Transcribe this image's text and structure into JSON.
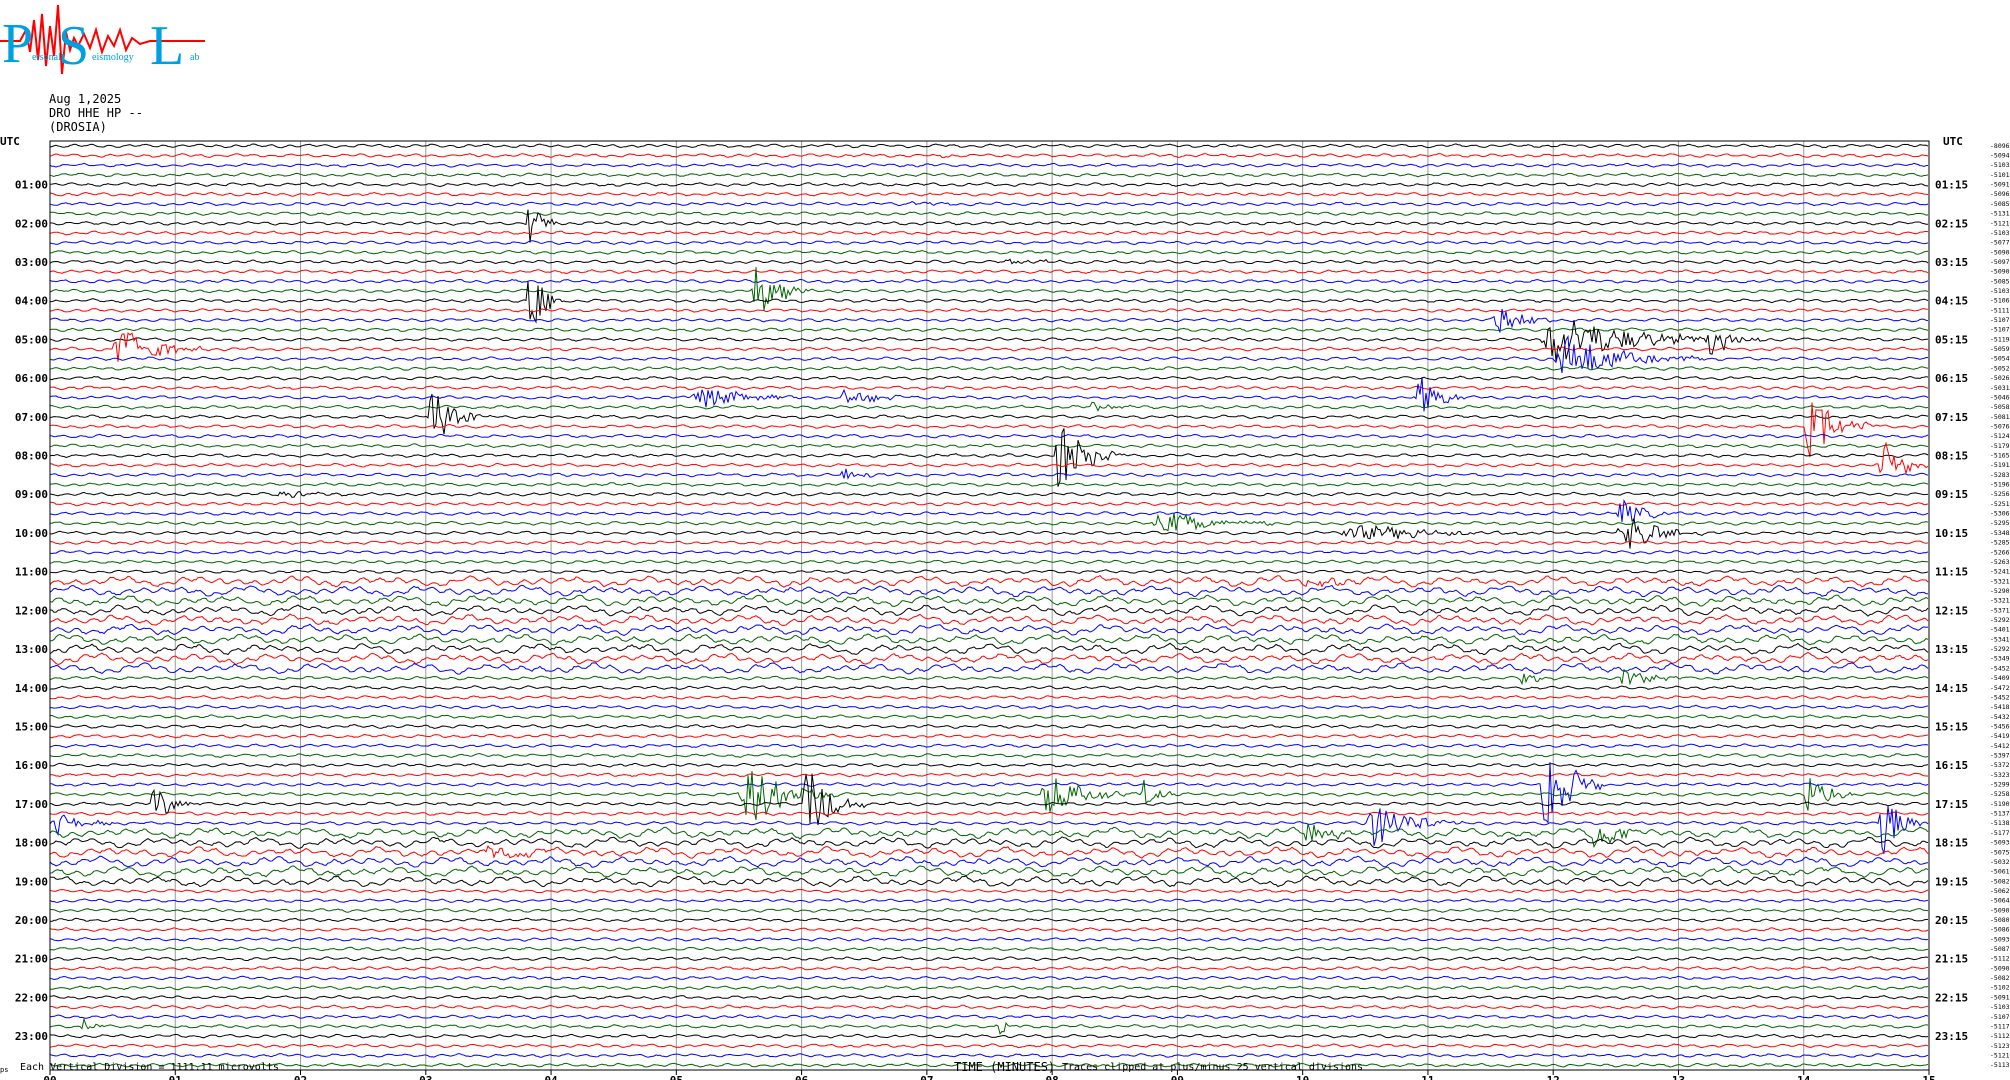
{
  "logo": {
    "letters": [
      "P",
      "S",
      "L"
    ],
    "text_fragments": [
      "ersonal",
      "eismology",
      "ab"
    ],
    "colors": {
      "letters": "#00a0e0",
      "trace": "#ff0000"
    }
  },
  "header": {
    "date": "Aug 1,2025",
    "station": "DRO HHE HP --",
    "place": "(DROSIA)"
  },
  "footer": {
    "mark": "ps",
    "scale_note": "Each Vertical Division = 1111.11 microvolts",
    "xlabel": "TIME (MINUTES)",
    "clip_note": "Traces clipped at plus/minus 25 vertical divisions"
  },
  "chart_data": {
    "type": "line",
    "subtype": "helicorder",
    "x_range": [
      0,
      15
    ],
    "x_unit": "minutes",
    "x_ticks": [
      "00",
      "01",
      "02",
      "03",
      "04",
      "05",
      "06",
      "07",
      "08",
      "09",
      "10",
      "11",
      "12",
      "13",
      "14",
      "15"
    ],
    "left_axis_title": "UTC",
    "right_axis_title": "UTC",
    "left_time_labels": [
      "01:00",
      "02:00",
      "03:00",
      "04:00",
      "05:00",
      "06:00",
      "07:00",
      "08:00",
      "09:00",
      "10:00",
      "11:00",
      "12:00",
      "13:00",
      "14:00",
      "15:00",
      "16:00",
      "17:00",
      "18:00",
      "19:00",
      "20:00",
      "21:00",
      "22:00",
      "23:00"
    ],
    "right_time_labels": [
      "01:15",
      "02:15",
      "03:15",
      "04:15",
      "05:15",
      "06:15",
      "07:15",
      "08:15",
      "09:15",
      "10:15",
      "11:15",
      "12:15",
      "13:15",
      "14:15",
      "15:15",
      "16:15",
      "17:15",
      "18:15",
      "19:15",
      "20:15",
      "21:15",
      "22:15",
      "23:15"
    ],
    "line_count": 96,
    "line_duration_minutes": 15,
    "trace_colors": [
      "#000000",
      "#ff0000",
      "#0000ff",
      "#006400"
    ],
    "right_offsets": [
      "-8096",
      "-5094",
      "-5103",
      "-5101",
      "-5091",
      "-5096",
      "-5085",
      "-5131",
      "-5121",
      "-5103",
      "-5077",
      "-5090",
      "-5097",
      "-5090",
      "-5085",
      "-5103",
      "-5106",
      "-5111",
      "-5107",
      "-5107",
      "-5119",
      "-5059",
      "-5054",
      "-5052",
      "-5026",
      "-5031",
      "-5046",
      "-5058",
      "-5081",
      "-5076",
      "-5124",
      "-5179",
      "-5165",
      "-5191",
      "-5283",
      "-5196",
      "-5256",
      "-5251",
      "-5306",
      "-5295",
      "-5348",
      "-5285",
      "-5266",
      "-5263",
      "-5241",
      "-5321",
      "-5290",
      "-5321",
      "-5371",
      "-5292",
      "-5401",
      "-5341",
      "-5292",
      "-5349",
      "-5452",
      "-5409",
      "-5472",
      "-5452",
      "-5418",
      "-5432",
      "-5456",
      "-5419",
      "-5412",
      "-5397",
      "-5372",
      "-5323",
      "-5299",
      "-5258",
      "-5190",
      "-5137",
      "-5138",
      "-5177",
      "-5093",
      "-5075",
      "-5032",
      "-5061",
      "-5082",
      "-5062",
      "-5064",
      "-5090",
      "-5080",
      "-5086",
      "-5093",
      "-5087",
      "-5112",
      "-5090",
      "-5082",
      "-5102",
      "-5091",
      "-5103",
      "-5107",
      "-5117",
      "-5112",
      "-5123",
      "-5121",
      "-5113"
    ],
    "events": [
      {
        "line": 1,
        "minute": 7.05,
        "dur": 0.25,
        "amp": 4
      },
      {
        "line": 6,
        "minute": 6.85,
        "dur": 0.4,
        "amp": 5
      },
      {
        "line": 8,
        "minute": 3.8,
        "dur": 0.3,
        "amp": 28
      },
      {
        "line": 12,
        "minute": 7.6,
        "dur": 0.6,
        "amp": 5
      },
      {
        "line": 15,
        "minute": 5.6,
        "dur": 0.5,
        "amp": 40
      },
      {
        "line": 16,
        "minute": 3.8,
        "dur": 0.3,
        "amp": 55
      },
      {
        "line": 18,
        "minute": 11.5,
        "dur": 0.5,
        "amp": 30
      },
      {
        "line": 20,
        "minute": 11.9,
        "dur": 1.5,
        "amp": 35
      },
      {
        "line": 20,
        "minute": 13.2,
        "dur": 0.5,
        "amp": 22
      },
      {
        "line": 21,
        "minute": 0.5,
        "dur": 0.7,
        "amp": 35
      },
      {
        "line": 22,
        "minute": 12.0,
        "dur": 1.2,
        "amp": 30
      },
      {
        "line": 26,
        "minute": 5.1,
        "dur": 0.9,
        "amp": 16
      },
      {
        "line": 26,
        "minute": 6.3,
        "dur": 0.6,
        "amp": 12
      },
      {
        "line": 26,
        "minute": 10.9,
        "dur": 0.4,
        "amp": 30
      },
      {
        "line": 27,
        "minute": 8.3,
        "dur": 0.4,
        "amp": 8
      },
      {
        "line": 28,
        "minute": 3.0,
        "dur": 0.5,
        "amp": 40
      },
      {
        "line": 29,
        "minute": 14.0,
        "dur": 0.6,
        "amp": 40
      },
      {
        "line": 32,
        "minute": 8.0,
        "dur": 0.6,
        "amp": 45
      },
      {
        "line": 33,
        "minute": 14.6,
        "dur": 0.4,
        "amp": 35
      },
      {
        "line": 34,
        "minute": 6.3,
        "dur": 0.4,
        "amp": 8
      },
      {
        "line": 36,
        "minute": 1.8,
        "dur": 0.6,
        "amp": 6
      },
      {
        "line": 38,
        "minute": 12.5,
        "dur": 0.5,
        "amp": 18
      },
      {
        "line": 39,
        "minute": 8.8,
        "dur": 1.0,
        "amp": 18
      },
      {
        "line": 40,
        "minute": 12.5,
        "dur": 0.7,
        "amp": 30
      },
      {
        "line": 40,
        "minute": 10.3,
        "dur": 1.5,
        "amp": 12
      },
      {
        "line": 45,
        "minute": 10.0,
        "dur": 0.6,
        "amp": 10
      },
      {
        "line": 55,
        "minute": 11.7,
        "dur": 0.4,
        "amp": 8
      },
      {
        "line": 55,
        "minute": 12.5,
        "dur": 0.6,
        "amp": 12
      },
      {
        "line": 66,
        "minute": 11.9,
        "dur": 0.5,
        "amp": 70
      },
      {
        "line": 67,
        "minute": 5.5,
        "dur": 0.8,
        "amp": 45
      },
      {
        "line": 67,
        "minute": 7.9,
        "dur": 0.7,
        "amp": 30
      },
      {
        "line": 67,
        "minute": 8.7,
        "dur": 0.3,
        "amp": 22
      },
      {
        "line": 67,
        "minute": 14.0,
        "dur": 0.4,
        "amp": 28
      },
      {
        "line": 68,
        "minute": 6.0,
        "dur": 0.5,
        "amp": 55
      },
      {
        "line": 68,
        "minute": 0.8,
        "dur": 0.4,
        "amp": 25
      },
      {
        "line": 70,
        "minute": 0.0,
        "dur": 0.5,
        "amp": 18
      },
      {
        "line": 70,
        "minute": 10.5,
        "dur": 0.8,
        "amp": 30
      },
      {
        "line": 71,
        "minute": 10.0,
        "dur": 0.4,
        "amp": 18
      },
      {
        "line": 71,
        "minute": 12.3,
        "dur": 0.5,
        "amp": 22
      },
      {
        "line": 70,
        "minute": 14.6,
        "dur": 0.4,
        "amp": 40
      },
      {
        "line": 73,
        "minute": 3.4,
        "dur": 0.8,
        "amp": 8
      },
      {
        "line": 91,
        "minute": 0.25,
        "dur": 0.2,
        "amp": 15
      },
      {
        "line": 91,
        "minute": 7.55,
        "dur": 0.2,
        "amp": 15
      }
    ]
  }
}
